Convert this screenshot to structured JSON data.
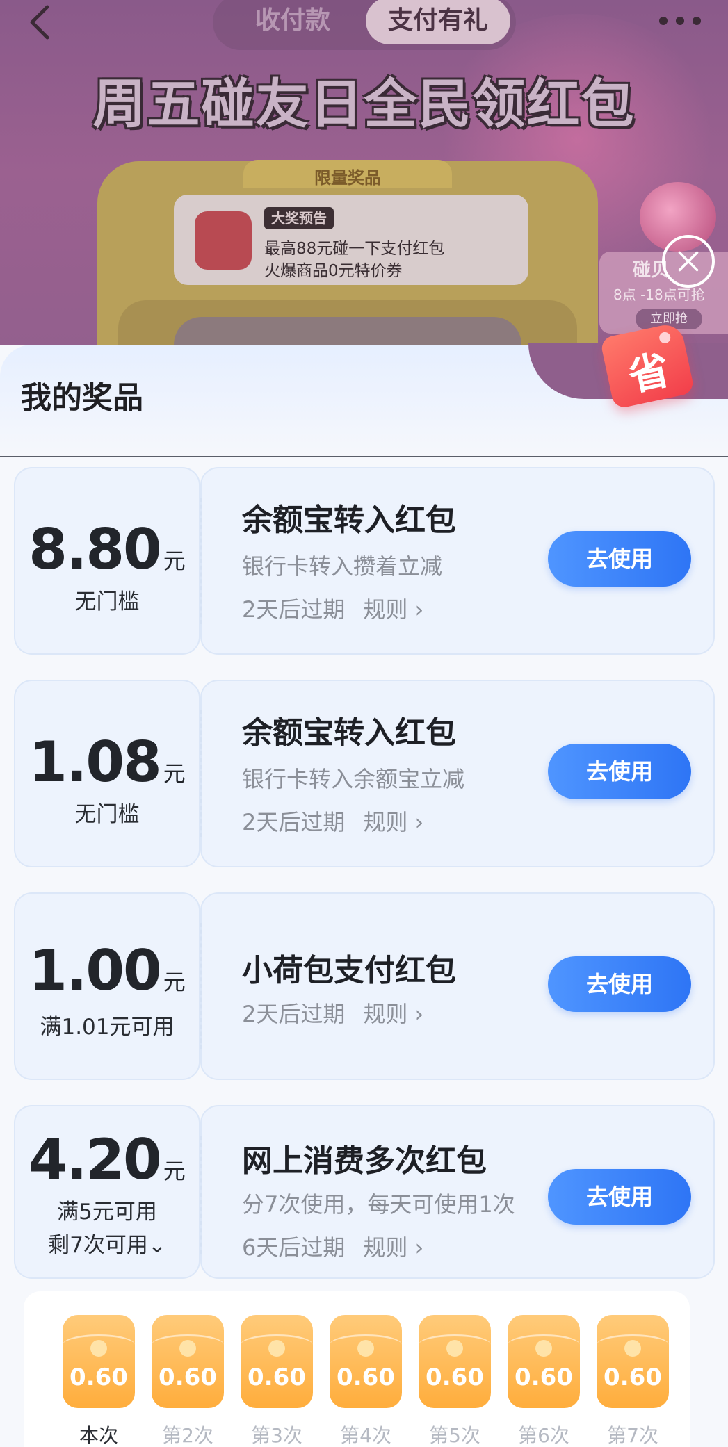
{
  "colors": {
    "accent_blue": "#2e75f5",
    "coupon_bg": "#edf3fd",
    "packet_orange": "#ffad3c",
    "save_tag_red": "#f23e4a"
  },
  "top_bar": {
    "back_icon": "chevron-left-icon",
    "tabs": [
      "收付款",
      "支付有礼"
    ],
    "active_tab": "支付有礼",
    "more_icon": "more-dots-icon"
  },
  "banner": {
    "title": "周五碰友日全民领红包",
    "machine_label": "限量奖品",
    "badge": "大奖预告",
    "line1": "最高88元碰一下支付红包",
    "line2": "火爆商品0元特价券",
    "side_title": "碰贝",
    "side_sub": "8点 -18点可抢",
    "side_button": "立即抢"
  },
  "sheet": {
    "title": "我的奖品",
    "save_tag": "省"
  },
  "coupons": [
    {
      "amount": "8.80",
      "unit": "元",
      "condition": "无门槛",
      "title": "余额宝转入红包",
      "desc": "银行卡转入攒着立减",
      "expiry": "2天后过期",
      "rules": "规则 ›",
      "button": "去使用"
    },
    {
      "amount": "1.08",
      "unit": "元",
      "condition": "无门槛",
      "title": "余额宝转入红包",
      "desc": "银行卡转入余额宝立减",
      "expiry": "2天后过期",
      "rules": "规则 ›",
      "button": "去使用"
    },
    {
      "amount": "1.00",
      "unit": "元",
      "condition": "满1.01元可用",
      "title": "小荷包支付红包",
      "expiry": "2天后过期",
      "rules": "规则 ›",
      "button": "去使用"
    },
    {
      "amount": "4.20",
      "unit": "元",
      "condition": "满5元可用",
      "remaining": "剩7次可用",
      "title": "网上消费多次红包",
      "desc": "分7次使用，每天可使用1次",
      "expiry": "6天后过期",
      "rules": "规则 ›",
      "button": "去使用"
    }
  ],
  "packets": [
    {
      "value": "0.60",
      "label": "本次",
      "current": true
    },
    {
      "value": "0.60",
      "label": "第2次",
      "current": false
    },
    {
      "value": "0.60",
      "label": "第3次",
      "current": false
    },
    {
      "value": "0.60",
      "label": "第4次",
      "current": false
    },
    {
      "value": "0.60",
      "label": "第5次",
      "current": false
    },
    {
      "value": "0.60",
      "label": "第6次",
      "current": false
    },
    {
      "value": "0.60",
      "label": "第7次",
      "current": false
    }
  ]
}
